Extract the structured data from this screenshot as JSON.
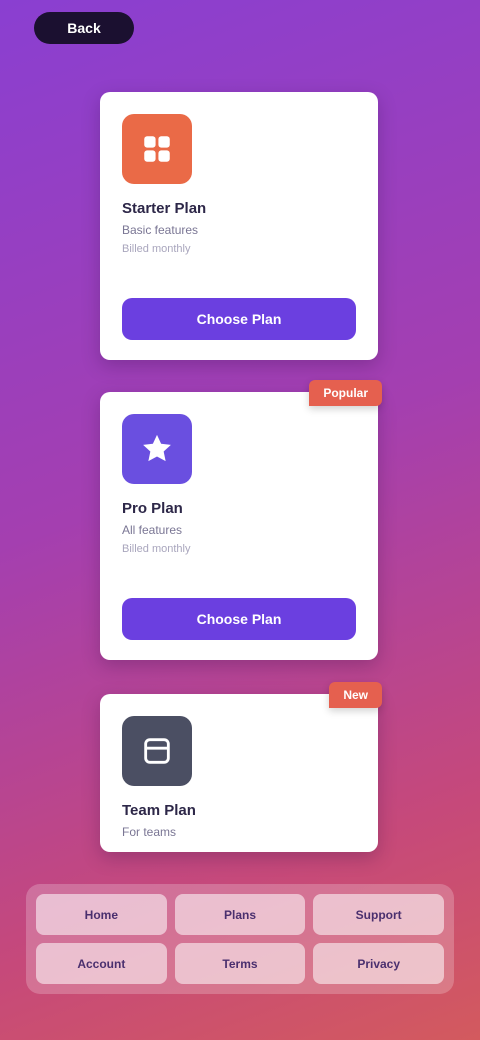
{
  "header": {
    "pill_label": "Back"
  },
  "cards": [
    {
      "icon": "grid-app-icon",
      "icon_color": "#ea6a47",
      "title": "Starter Plan",
      "subtitle": "Basic features",
      "note": "Billed monthly",
      "cta": "Choose Plan"
    },
    {
      "badge": "Popular",
      "icon": "star-app-icon",
      "icon_color": "#6a4fe0",
      "title": "Pro Plan",
      "subtitle": "All features",
      "note": "Billed monthly",
      "cta": "Choose Plan"
    },
    {
      "badge": "New",
      "icon": "box-app-icon",
      "icon_color": "#4b4f63",
      "title": "Team Plan",
      "subtitle": "For teams"
    }
  ],
  "footer": {
    "items": [
      "Home",
      "Plans",
      "Support",
      "Account",
      "Terms",
      "Privacy"
    ]
  },
  "colors": {
    "gradient_start": "#8a3fd1",
    "gradient_end": "#d35a5e",
    "accent": "#6b3fe0",
    "ribbon": "#e5604f"
  }
}
